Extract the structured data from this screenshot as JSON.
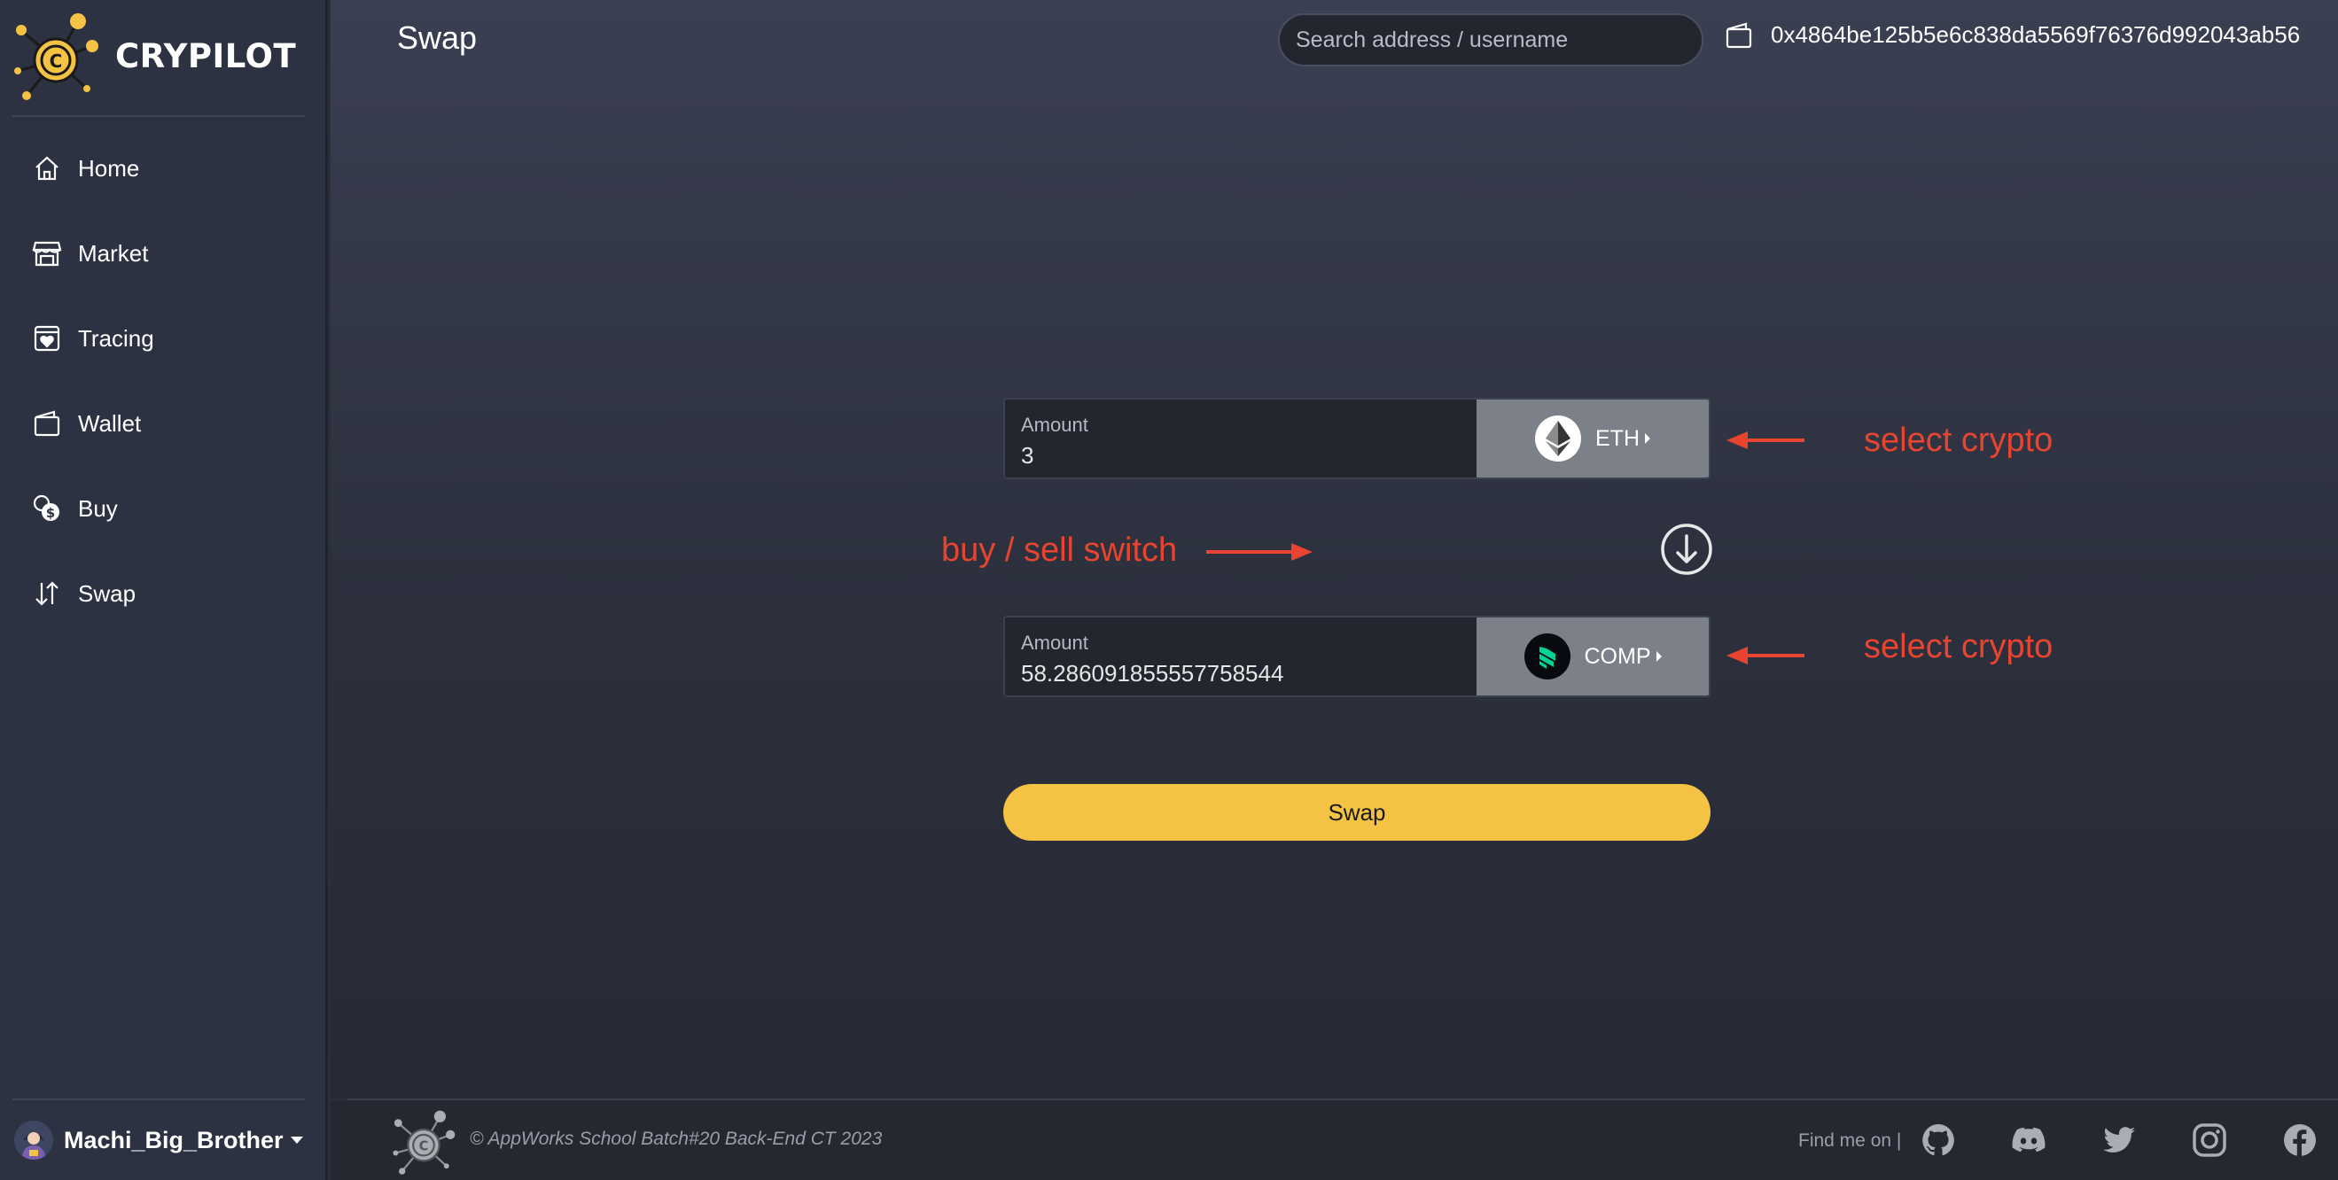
{
  "brand": {
    "name": "CRYPILOT"
  },
  "sidebar": {
    "items": [
      {
        "label": "Home",
        "icon": "home-icon"
      },
      {
        "label": "Market",
        "icon": "store-icon"
      },
      {
        "label": "Tracing",
        "icon": "heart-box-icon"
      },
      {
        "label": "Wallet",
        "icon": "wallet-icon"
      },
      {
        "label": "Buy",
        "icon": "coins-icon"
      },
      {
        "label": "Swap",
        "icon": "swap-arrows-icon"
      }
    ],
    "user": {
      "name": "Machi_Big_Brother"
    }
  },
  "header": {
    "title": "Swap",
    "search_placeholder": "Search address / username",
    "wallet_address": "0x4864be125b5e6c838da5569f76376d992043ab56"
  },
  "swap": {
    "from": {
      "label": "Amount",
      "value": "3",
      "coin": "ETH"
    },
    "to": {
      "label": "Amount",
      "value": "58.286091855557758544",
      "coin": "COMP"
    },
    "button_label": "Swap"
  },
  "annotations": {
    "from_select": "select crypto",
    "switch": "buy / sell switch",
    "to_select": "select crypto"
  },
  "footer": {
    "copyright": "© AppWorks School Batch#20 Back-End CT 2023",
    "find_me": "Find me on |",
    "socials": [
      "github-icon",
      "discord-icon",
      "twitter-icon",
      "instagram-icon",
      "facebook-icon"
    ]
  },
  "colors": {
    "accent": "#f5c343",
    "annotation": "#e8442f",
    "sidebar": "#2d3242",
    "coin_button": "#7c8089"
  }
}
